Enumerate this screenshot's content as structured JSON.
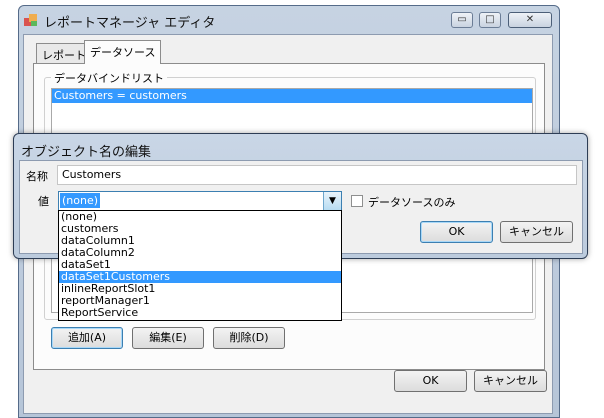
{
  "main_window": {
    "title": "レポートマネージャ エディタ",
    "caption_buttons": {
      "minimize": "▭",
      "maximize": "□",
      "close": "✕"
    },
    "tabs": [
      {
        "label": "レポート",
        "active": false
      },
      {
        "label": "データソース",
        "active": true
      }
    ],
    "groupbox_label": "データバインドリスト",
    "bind_list": [
      "Customers = customers"
    ],
    "buttons": {
      "add": "追加(A)",
      "edit": "編集(E)",
      "delete": "削除(D)",
      "ok": "OK",
      "cancel": "キャンセル"
    }
  },
  "edit_dialog": {
    "title": "オブジェクト名の編集",
    "name_label": "名称",
    "name_value": "Customers",
    "value_label": "値",
    "combo_selected": "(none)",
    "checkbox_label": "データソースのみ",
    "checkbox_checked": false,
    "ok": "OK",
    "cancel": "キャンセル",
    "dropdown_options": [
      "(none)",
      "customers",
      "dataColumn1",
      "dataColumn2",
      "dataSet1",
      "dataSet1Customers",
      "inlineReportSlot1",
      "reportManager1",
      "ReportService"
    ],
    "dropdown_highlighted": "dataSet1Customers"
  },
  "colors": {
    "selection": "#3399ff",
    "title_bar": "#c6d3e2"
  }
}
